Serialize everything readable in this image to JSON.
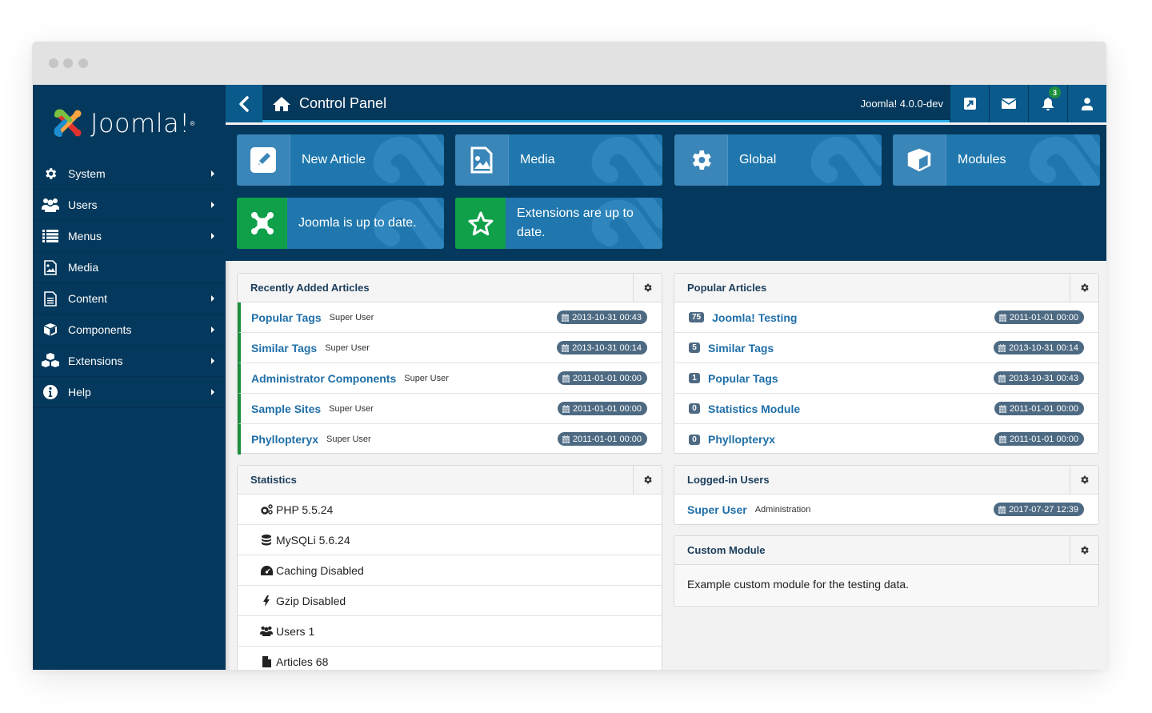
{
  "window": {
    "controls": [
      "close",
      "minimize",
      "maximize"
    ]
  },
  "sidebar": {
    "logo_text": "Joomla!",
    "logo_mark": "®",
    "items": [
      {
        "label": "System",
        "icon": "gear-icon",
        "has_submenu": true
      },
      {
        "label": "Users",
        "icon": "users-icon",
        "has_submenu": true
      },
      {
        "label": "Menus",
        "icon": "list-icon",
        "has_submenu": true
      },
      {
        "label": "Media",
        "icon": "image-icon",
        "has_submenu": false
      },
      {
        "label": "Content",
        "icon": "file-icon",
        "has_submenu": true
      },
      {
        "label": "Components",
        "icon": "cube-icon",
        "has_submenu": true
      },
      {
        "label": "Extensions",
        "icon": "cubes-icon",
        "has_submenu": true
      },
      {
        "label": "Help",
        "icon": "info-icon",
        "has_submenu": true
      }
    ]
  },
  "header": {
    "title": "Control Panel",
    "version": "Joomla! 4.0.0-dev",
    "notification_count": "3",
    "buttons": [
      "external-link-icon",
      "mail-icon",
      "bell-icon",
      "user-icon"
    ]
  },
  "quick_icons": [
    {
      "label": "New Article",
      "icon": "pencil-icon",
      "status": "normal"
    },
    {
      "label": "Media",
      "icon": "image-icon",
      "status": "normal"
    },
    {
      "label": "Global",
      "icon": "gear-icon",
      "status": "normal"
    },
    {
      "label": "Modules",
      "icon": "cube-icon",
      "status": "normal"
    },
    {
      "label": "Joomla is up to date.",
      "icon": "joomla-icon",
      "status": "success"
    },
    {
      "label": "Extensions are up to date.",
      "icon": "star-icon",
      "status": "success"
    }
  ],
  "recent_articles": {
    "title": "Recently Added Articles",
    "rows": [
      {
        "title": "Popular Tags",
        "author": "Super User",
        "date": "2013-10-31 00:43"
      },
      {
        "title": "Similar Tags",
        "author": "Super User",
        "date": "2013-10-31 00:14"
      },
      {
        "title": "Administrator Components",
        "author": "Super User",
        "date": "2011-01-01 00:00"
      },
      {
        "title": "Sample Sites",
        "author": "Super User",
        "date": "2011-01-01 00:00"
      },
      {
        "title": "Phyllopteryx",
        "author": "Super User",
        "date": "2011-01-01 00:00"
      }
    ]
  },
  "popular_articles": {
    "title": "Popular Articles",
    "rows": [
      {
        "hits": "75",
        "title": "Joomla! Testing",
        "date": "2011-01-01 00:00"
      },
      {
        "hits": "5",
        "title": "Similar Tags",
        "date": "2013-10-31 00:14"
      },
      {
        "hits": "1",
        "title": "Popular Tags",
        "date": "2013-10-31 00:43"
      },
      {
        "hits": "0",
        "title": "Statistics Module",
        "date": "2011-01-01 00:00"
      },
      {
        "hits": "0",
        "title": "Phyllopteryx",
        "date": "2011-01-01 00:00"
      }
    ]
  },
  "statistics": {
    "title": "Statistics",
    "rows": [
      {
        "icon": "cogs-icon",
        "label": "PHP 5.5.24"
      },
      {
        "icon": "database-icon",
        "label": "MySQLi 5.6.24"
      },
      {
        "icon": "dashboard-icon",
        "label": "Caching Disabled"
      },
      {
        "icon": "bolt-icon",
        "label": "Gzip Disabled"
      },
      {
        "icon": "users-icon",
        "label": "Users 1"
      },
      {
        "icon": "file-icon",
        "label": "Articles 68"
      }
    ]
  },
  "logged_in_users": {
    "title": "Logged-in Users",
    "rows": [
      {
        "name": "Super User",
        "client": "Administration",
        "date": "2017-07-27 12:39"
      }
    ]
  },
  "custom_module": {
    "title": "Custom Module",
    "body": "Example custom module for the testing data."
  },
  "colors": {
    "sidebar_bg": "#04385c",
    "header_accent": "#2db0e8",
    "tile_blue": "#1f77ad",
    "tile_green": "#10a04a",
    "link": "#1f6fa8",
    "pill": "#4d6a82",
    "success_bar": "#1e8f3e"
  }
}
